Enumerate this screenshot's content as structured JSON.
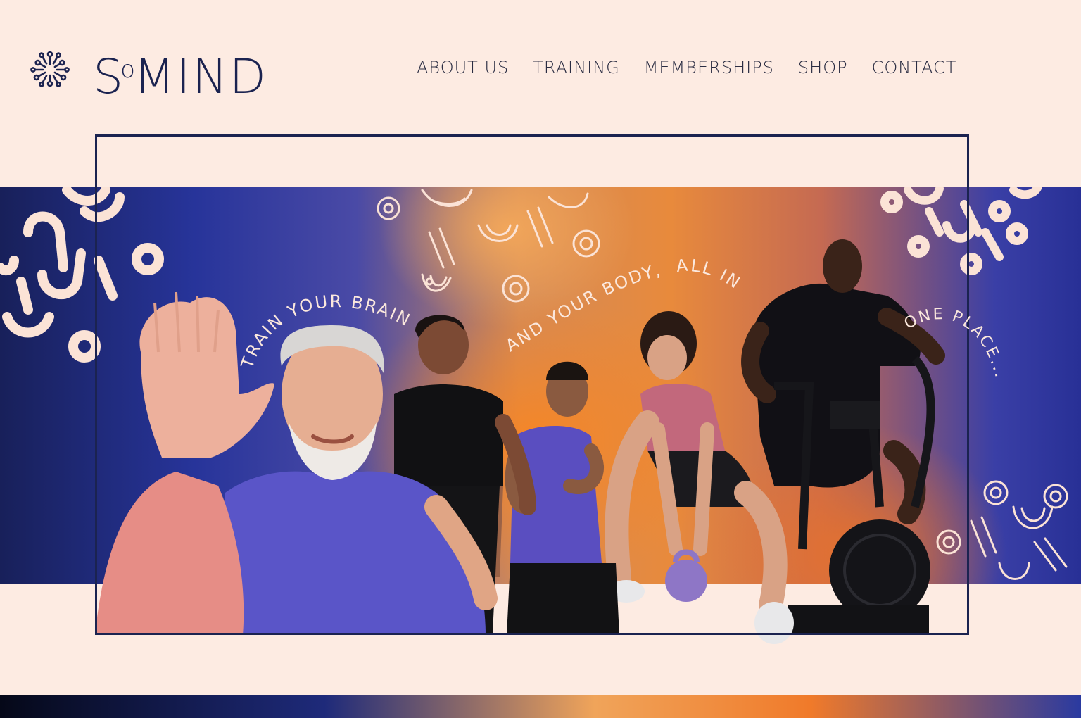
{
  "brand": {
    "name_part1": "S",
    "name_small_o": "o",
    "name_part2": "MIND"
  },
  "nav": {
    "items": [
      {
        "label": "ABOUT US"
      },
      {
        "label": "TRAINING"
      },
      {
        "label": "MEMBERSHIPS"
      },
      {
        "label": "SHOP"
      },
      {
        "label": "CONTACT"
      }
    ]
  },
  "hero": {
    "tagline_1": "TRAIN YOUR BRAIN",
    "tagline_2": "AND YOUR BODY,  ALL IN",
    "tagline_3": "ONE PLACE..."
  },
  "colors": {
    "navy": "#1b2350",
    "cream": "#fdebe2",
    "orange": "#f7862a",
    "blue": "#2a35a0"
  }
}
